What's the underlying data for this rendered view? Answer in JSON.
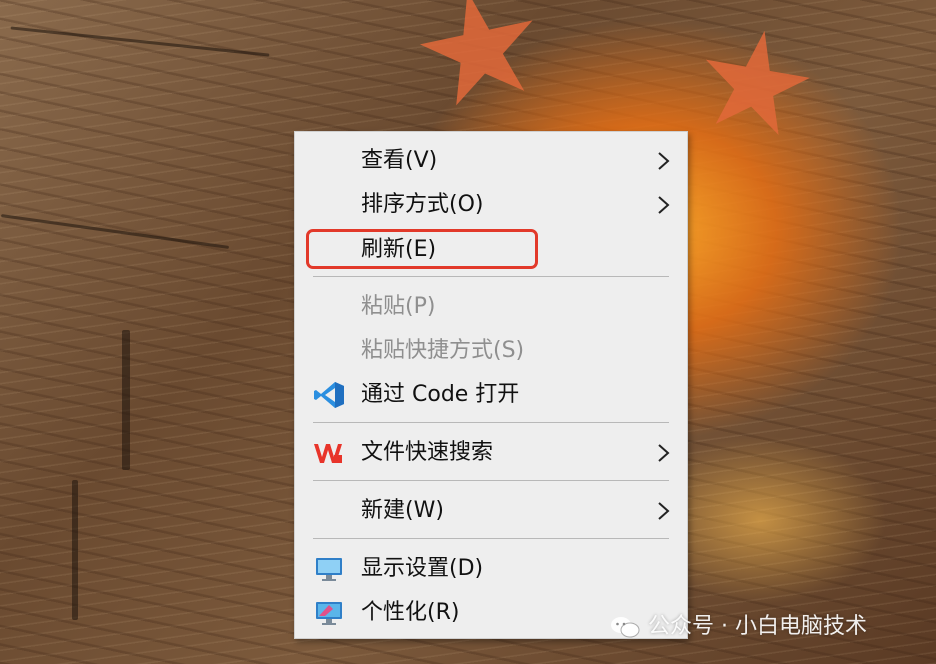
{
  "menu": {
    "items": [
      {
        "label": "查看(V)",
        "submenu": true,
        "enabled": true
      },
      {
        "label": "排序方式(O)",
        "submenu": true,
        "enabled": true
      },
      {
        "label": "刷新(E)",
        "submenu": false,
        "enabled": true,
        "highlighted": true
      },
      {
        "label": "粘贴(P)",
        "submenu": false,
        "enabled": false
      },
      {
        "label": "粘贴快捷方式(S)",
        "submenu": false,
        "enabled": false
      },
      {
        "label": "通过 Code 打开",
        "submenu": false,
        "enabled": true,
        "icon": "vscode-icon"
      },
      {
        "label": "文件快速搜索",
        "submenu": true,
        "enabled": true,
        "icon": "wps-icon"
      },
      {
        "label": "新建(W)",
        "submenu": true,
        "enabled": true
      },
      {
        "label": "显示设置(D)",
        "submenu": false,
        "enabled": true,
        "icon": "display-settings-icon"
      },
      {
        "label": "个性化(R)",
        "submenu": false,
        "enabled": true,
        "icon": "personalize-icon"
      }
    ],
    "highlight_color": "#e2392a"
  },
  "watermark": {
    "text": "公众号 · 小白电脑技术",
    "icon": "wechat-icon"
  }
}
